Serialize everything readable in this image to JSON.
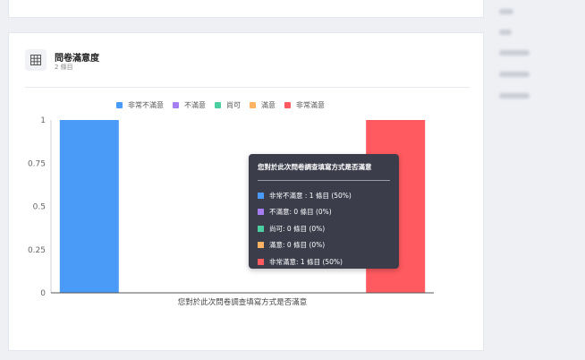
{
  "card": {
    "title": "問卷滿意度",
    "subtitle": "2 條目",
    "icon": "table-grid-icon"
  },
  "colors": {
    "very_dissatisfied": "#4a9bf7",
    "dissatisfied": "#a77ef2",
    "neutral": "#4ccfa0",
    "satisfied": "#ffb363",
    "very_satisfied": "#ff5a5f"
  },
  "chart_data": {
    "type": "bar",
    "categories": [
      "您對於此次問卷調查填寫方式是否滿意"
    ],
    "series": [
      {
        "name": "非常不滿意",
        "values": [
          1
        ],
        "color": "#4a9bf7"
      },
      {
        "name": "不滿意",
        "values": [
          0
        ],
        "color": "#a77ef2"
      },
      {
        "name": "尚可",
        "values": [
          0
        ],
        "color": "#4ccfa0"
      },
      {
        "name": "滿意",
        "values": [
          0
        ],
        "color": "#ffb363"
      },
      {
        "name": "非常滿意",
        "values": [
          1
        ],
        "color": "#ff5a5f"
      }
    ],
    "yticks": [
      "0",
      "0.25",
      "0.5",
      "0.75",
      "1"
    ],
    "ylim": [
      0,
      1
    ],
    "legend_position": "top-center",
    "grid": false
  },
  "tooltip": {
    "title": "您對於此次問卷調查填寫方式是否滿意",
    "rows": [
      {
        "text": "非常不滿意 : 1 條目 (50%)",
        "color": "#4a9bf7"
      },
      {
        "text": "不滿意: 0 條目 (0%)",
        "color": "#a77ef2"
      },
      {
        "text": "尚可: 0 條目 (0%)",
        "color": "#4ccfa0"
      },
      {
        "text": "滿意: 0 條目 (0%)",
        "color": "#ffb363"
      },
      {
        "text": "非常滿意: 1 條目 (50%)",
        "color": "#ff5a5f"
      }
    ]
  }
}
